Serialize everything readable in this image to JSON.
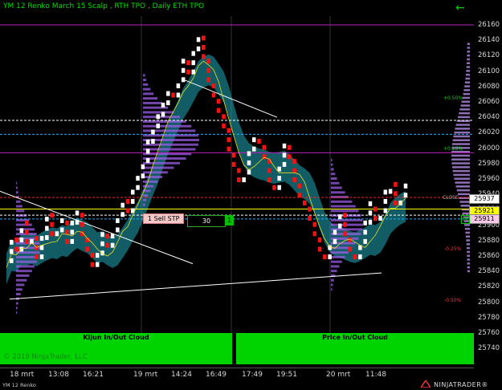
{
  "chart_title": "YM 12 Renko March 15 Scalp , RTH TPO , Daily ETH TPO",
  "price_axis": [
    "26160",
    "26140",
    "26120",
    "26100",
    "26080",
    "26060",
    "26040",
    "26020",
    "26000",
    "25980",
    "25960",
    "25940",
    "25920",
    "25900",
    "25880",
    "25860",
    "25840",
    "25820",
    "25800",
    "25780",
    "25760",
    "25740"
  ],
  "time_axis": [
    "18 mrt",
    "13:08",
    "16:21",
    "19 mrt",
    "14:24",
    "16:49",
    "17:49",
    "19:51",
    "20 mrt",
    "11:48"
  ],
  "panels": {
    "kijun": "Kijun In/Out Cloud",
    "price": "Price In/Out Cloud"
  },
  "copyright": "© 2019 NinjaTrader, LLC",
  "instrument": "YM 12 Renko",
  "brand": "NINJATRADER®",
  "order": {
    "label": "1 Sell STP",
    "quantity": "30",
    "close": "1"
  },
  "price_markers": {
    "close_label": "CLOSE",
    "last": "25937",
    "bid": "25921",
    "stop": "25911"
  },
  "percent_labels": {
    "p050": "+0.50%",
    "p025": "+0.25%",
    "m025": "-0.25%",
    "m050": "-0.50%"
  },
  "colors": {
    "up_bar": "#ffffff",
    "down_bar": "#ff1010",
    "cloud": "#1fa7b8",
    "profile": "#9b5de5",
    "panel": "#00d400",
    "title": "#00e000"
  },
  "chart_data": {
    "type": "renko",
    "title": "YM 12 Renko March 15 Scalp , RTH TPO , Daily ETH TPO",
    "ylim": [
      25730,
      26170
    ],
    "ticks": [
      25740,
      25760,
      25780,
      25800,
      25820,
      25840,
      25860,
      25880,
      25900,
      25920,
      25940,
      25960,
      25980,
      26000,
      26020,
      26040,
      26060,
      26080,
      26100,
      26120,
      26140,
      26160
    ],
    "x_labels": [
      "18 mrt",
      "13:08",
      "16:21",
      "19 mrt",
      "14:24",
      "16:49",
      "17:49",
      "19:51",
      "20 mrt",
      "11:48"
    ],
    "levels": [
      {
        "value": 26160,
        "color": "#c020c0"
      },
      {
        "value": 26036,
        "color": "#ffffff"
      },
      {
        "value": 26018,
        "color": "#20b0ff"
      },
      {
        "value": 25994,
        "color": "#c020c0"
      },
      {
        "value": 25936,
        "color": "#ff2020"
      },
      {
        "value": 25921,
        "color": "#ffff00"
      },
      {
        "value": 25913,
        "color": "#ffffff"
      },
      {
        "value": 25908,
        "color": "#20b0ff"
      }
    ],
    "price_path": [
      25845,
      25880,
      25860,
      25895,
      25870,
      25880,
      25850,
      25875,
      25905,
      25880,
      25885,
      25900,
      25870,
      25895,
      25910,
      25880,
      25860,
      25840,
      25855,
      25880,
      25865,
      25885,
      25905,
      25925,
      25910,
      25940,
      25955,
      25975,
      26000,
      26020,
      26035,
      26050,
      26070,
      26060,
      26080,
      26105,
      26090,
      26120,
      26140,
      26110,
      26080,
      26060,
      26040,
      26020,
      25990,
      25970,
      25950,
      25960,
      25990,
      26010,
      26000,
      25980,
      25950,
      25940,
      25970,
      26000,
      25980,
      25950,
      25930,
      25920,
      25900,
      25880,
      25860,
      25850,
      25870,
      25890,
      25910,
      25880,
      25860,
      25850,
      25870,
      25895,
      25920,
      25900,
      25910,
      25935,
      25945,
      25920,
      25930,
      25945
    ]
  }
}
